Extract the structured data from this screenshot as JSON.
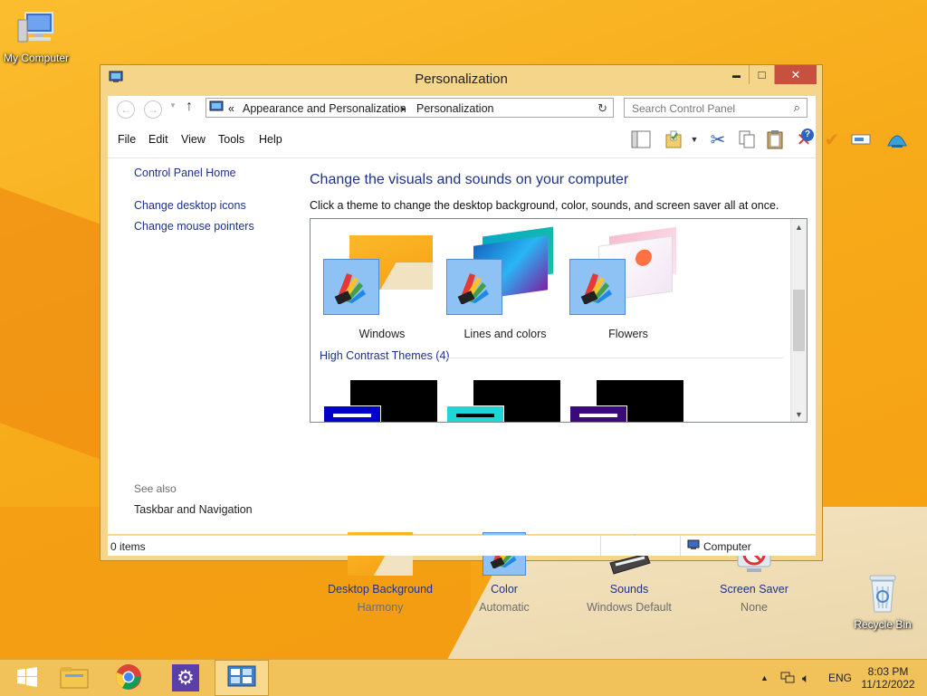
{
  "desktop": {
    "icons": [
      {
        "label": "My Computer"
      },
      {
        "label": "Recycle Bin"
      }
    ]
  },
  "window": {
    "title": "Personalization",
    "buttons": {
      "minimize": "▬",
      "maximize": "□",
      "close": "✕"
    }
  },
  "address": {
    "prefix": "«",
    "crumbs": [
      "Appearance and Personalization",
      "Personalization"
    ],
    "separator": "▸",
    "search_placeholder": "Search Control Panel"
  },
  "menu": [
    "File",
    "Edit",
    "View",
    "Tools",
    "Help"
  ],
  "sidebar": {
    "links": [
      "Control Panel Home",
      "Change desktop icons",
      "Change mouse pointers"
    ],
    "see_also_label": "See also",
    "see_also_links": [
      "Taskbar and Navigation"
    ]
  },
  "main": {
    "heading": "Change the visuals and sounds on your computer",
    "subtext": "Click a theme to change the desktop background, color, sounds, and screen saver all at once.",
    "themes": [
      {
        "name": "Windows"
      },
      {
        "name": "Lines and colors"
      },
      {
        "name": "Flowers"
      }
    ],
    "high_contrast_heading": "High Contrast Themes (4)",
    "bottom": [
      {
        "name": "Desktop Background",
        "value": "Harmony"
      },
      {
        "name": "Color",
        "value": "Automatic"
      },
      {
        "name": "Sounds",
        "value": "Windows Default"
      },
      {
        "name": "Screen Saver",
        "value": "None"
      }
    ]
  },
  "status": {
    "items": "0 items",
    "location": "Computer"
  },
  "taskbar": {
    "clock_time": "8:03 PM",
    "clock_date": "11/12/2022",
    "language": "ENG"
  },
  "colors": {
    "link": "#1e3287",
    "window_frame": "#f4d58a",
    "close_button": "#c7503f",
    "taskbar": "#f1c25a"
  }
}
